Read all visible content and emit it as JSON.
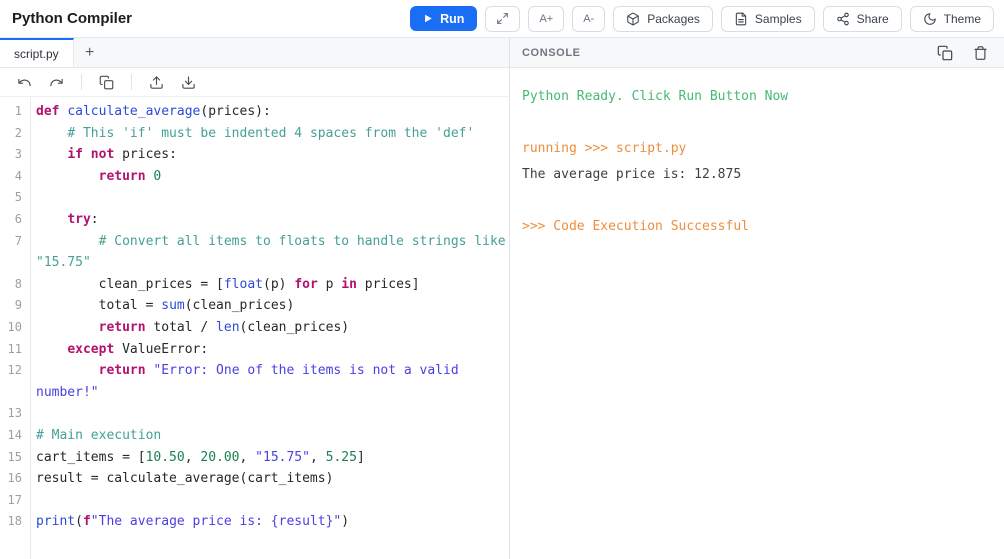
{
  "header": {
    "title": "Python Compiler",
    "run_label": "Run",
    "font_increase_label": "A+",
    "font_decrease_label": "A-",
    "packages_label": "Packages",
    "samples_label": "Samples",
    "share_label": "Share",
    "theme_label": "Theme"
  },
  "editor": {
    "tab_name": "script.py",
    "new_tab_label": "+",
    "lines": [
      {
        "no": 1,
        "tokens": [
          [
            "kw",
            "def"
          ],
          [
            "pl",
            " "
          ],
          [
            "def",
            "calculate_average"
          ],
          [
            "pl",
            "(prices):"
          ]
        ]
      },
      {
        "no": 2,
        "tokens": [
          [
            "pl",
            "    "
          ],
          [
            "cm",
            "# This 'if' must be indented 4 spaces from the 'def'"
          ]
        ]
      },
      {
        "no": 3,
        "tokens": [
          [
            "pl",
            "    "
          ],
          [
            "kw",
            "if"
          ],
          [
            "pl",
            " "
          ],
          [
            "kw",
            "not"
          ],
          [
            "pl",
            " prices:"
          ]
        ]
      },
      {
        "no": 4,
        "tokens": [
          [
            "pl",
            "        "
          ],
          [
            "kw",
            "return"
          ],
          [
            "pl",
            " "
          ],
          [
            "num",
            "0"
          ]
        ]
      },
      {
        "no": 5,
        "tokens": []
      },
      {
        "no": 6,
        "tokens": [
          [
            "pl",
            "    "
          ],
          [
            "kw",
            "try"
          ],
          [
            "pl",
            ":"
          ]
        ]
      },
      {
        "no": 7,
        "tokens": [
          [
            "pl",
            "        "
          ],
          [
            "cm",
            "# Convert all items to floats to handle strings like \"15.75\""
          ]
        ]
      },
      {
        "no": 8,
        "tokens": [
          [
            "pl",
            "        clean_prices = ["
          ],
          [
            "bi",
            "float"
          ],
          [
            "pl",
            "(p) "
          ],
          [
            "kw",
            "for"
          ],
          [
            "pl",
            " p "
          ],
          [
            "kw",
            "in"
          ],
          [
            "pl",
            " prices]"
          ]
        ]
      },
      {
        "no": 9,
        "tokens": [
          [
            "pl",
            "        total = "
          ],
          [
            "bi",
            "sum"
          ],
          [
            "pl",
            "(clean_prices)"
          ]
        ]
      },
      {
        "no": 10,
        "tokens": [
          [
            "pl",
            "        "
          ],
          [
            "kw",
            "return"
          ],
          [
            "pl",
            " total / "
          ],
          [
            "bi",
            "len"
          ],
          [
            "pl",
            "(clean_prices)"
          ]
        ]
      },
      {
        "no": 11,
        "tokens": [
          [
            "pl",
            "    "
          ],
          [
            "kw",
            "except"
          ],
          [
            "pl",
            " ValueError:"
          ]
        ]
      },
      {
        "no": 12,
        "tokens": [
          [
            "pl",
            "        "
          ],
          [
            "kw",
            "return"
          ],
          [
            "pl",
            " "
          ],
          [
            "str",
            "\"Error: One of the items is not a valid number!\""
          ]
        ]
      },
      {
        "no": 13,
        "tokens": []
      },
      {
        "no": 14,
        "tokens": [
          [
            "cm",
            "# Main execution"
          ]
        ]
      },
      {
        "no": 15,
        "tokens": [
          [
            "pl",
            "cart_items = ["
          ],
          [
            "num",
            "10.50"
          ],
          [
            "pl",
            ", "
          ],
          [
            "num",
            "20.00"
          ],
          [
            "pl",
            ", "
          ],
          [
            "str",
            "\"15.75\""
          ],
          [
            "pl",
            ", "
          ],
          [
            "num",
            "5.25"
          ],
          [
            "pl",
            "]"
          ]
        ]
      },
      {
        "no": 16,
        "tokens": [
          [
            "pl",
            "result = calculate_average(cart_items)"
          ]
        ]
      },
      {
        "no": 17,
        "tokens": []
      },
      {
        "no": 18,
        "tokens": [
          [
            "bi",
            "print"
          ],
          [
            "pl",
            "("
          ],
          [
            "kw",
            "f"
          ],
          [
            "str",
            "\"The average price is: {result}\""
          ],
          [
            "pl",
            ")"
          ]
        ]
      }
    ]
  },
  "console": {
    "title": "CONSOLE",
    "lines": [
      {
        "type": "ready",
        "text": "Python Ready. Click Run Button Now"
      },
      {
        "type": "blank",
        "text": ""
      },
      {
        "type": "running",
        "text": "running >>> script.py"
      },
      {
        "type": "output",
        "text": "The average price is: 12.875"
      },
      {
        "type": "blank",
        "text": ""
      },
      {
        "type": "success",
        "text": ">>> Code Execution Successful"
      }
    ]
  },
  "colors": {
    "accent_blue": "#1a6ef5",
    "keyword": "#b2126e",
    "builtin": "#2a4bd7",
    "string": "#4a3fe3",
    "comment": "#45a096",
    "number": "#1b8050",
    "plain": "#24292e",
    "line_number": "#9aa0a6",
    "console_ready_green": "#46b973",
    "console_running_orange": "#ee8e3c",
    "console_output_text": "#3c4146"
  }
}
